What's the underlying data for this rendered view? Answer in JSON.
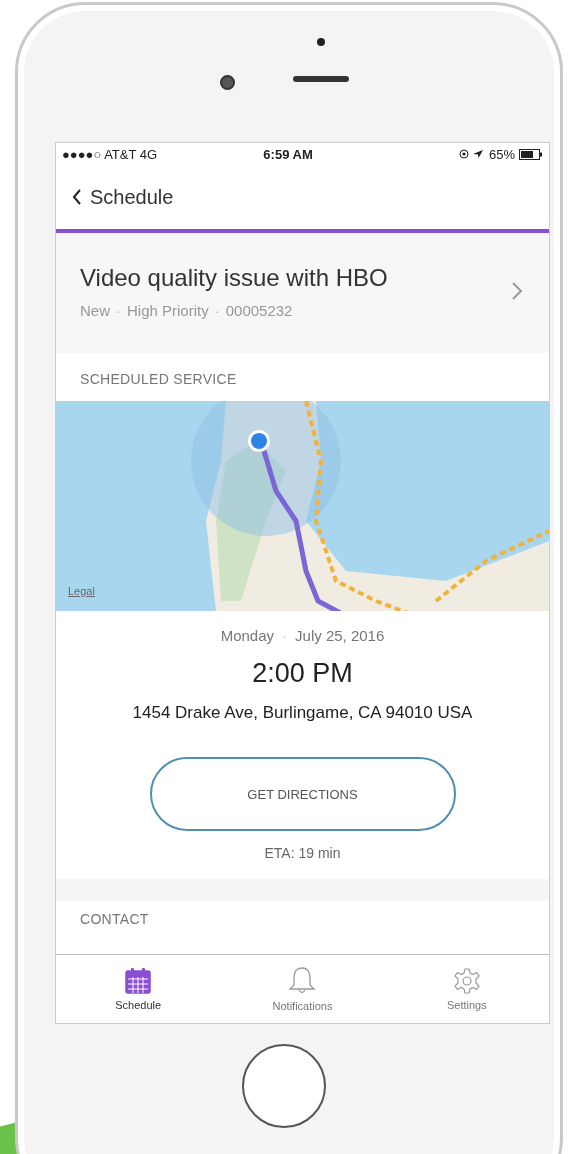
{
  "status_bar": {
    "carrier": "●●●●○ AT&T  4G",
    "time": "6:59 AM",
    "battery": "65%"
  },
  "nav": {
    "back_label": "Schedule"
  },
  "case": {
    "title": "Video quality issue with HBO",
    "status": "New",
    "priority": "High Priority",
    "number": "00005232",
    "separators": [
      "·",
      "·"
    ]
  },
  "scheduled_service": {
    "heading": "SCHEDULED SERVICE",
    "map": {
      "legal": "Legal"
    },
    "day": "Monday",
    "separator": "·",
    "date": "July 25, 2016",
    "time": "2:00 PM",
    "address": "1454 Drake Ave, Burlingame, CA 94010 USA",
    "button": "GET DIRECTIONS",
    "eta": "ETA: 19 min"
  },
  "next_section": {
    "heading": "CONTACT"
  },
  "tabs": [
    {
      "label": "Schedule",
      "kind": "calendar",
      "selected": true
    },
    {
      "label": "Notifications",
      "kind": "bell",
      "selected": false
    },
    {
      "label": "Settings",
      "kind": "gear",
      "selected": false
    }
  ]
}
